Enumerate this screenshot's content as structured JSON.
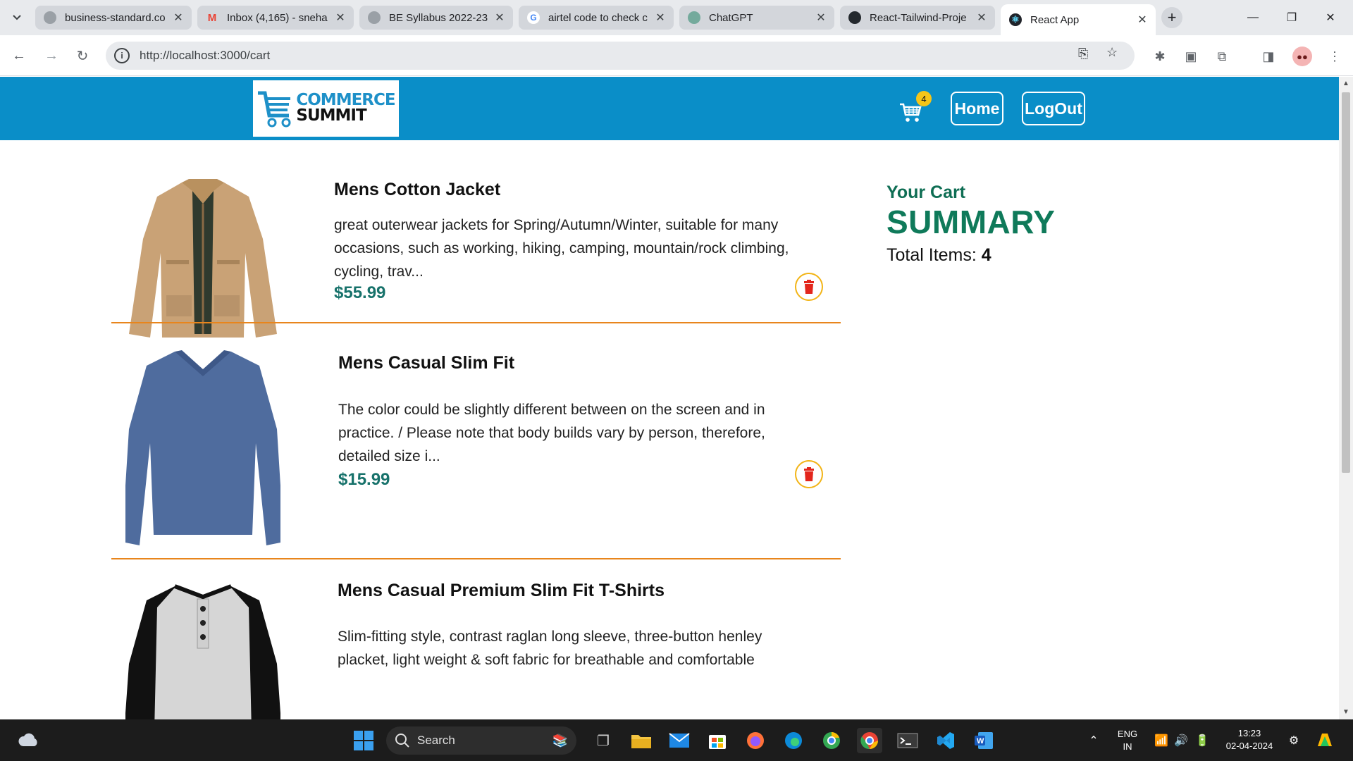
{
  "browser": {
    "tabs": [
      {
        "title": "business-standard.co",
        "icon": "globe-icon"
      },
      {
        "title": "Inbox (4,165) - sneha",
        "icon": "gmail-icon"
      },
      {
        "title": "BE Syllabus 2022-23.",
        "icon": "globe-icon"
      },
      {
        "title": "airtel code to check c",
        "icon": "google-icon"
      },
      {
        "title": "ChatGPT",
        "icon": "chatgpt-icon"
      },
      {
        "title": "React-Tailwind-Proje",
        "icon": "github-icon"
      },
      {
        "title": "React App",
        "icon": "react-icon"
      }
    ],
    "url": "http://localhost:3000/cart"
  },
  "navbar": {
    "logo_line1": "COMMERCE",
    "logo_line2": "SUMMIT",
    "cart_count": "4",
    "home_label": "Home",
    "logout_label": "LogOut"
  },
  "cart_items": [
    {
      "name": "Mens Cotton Jacket",
      "description": "great outerwear jackets for Spring/Autumn/Winter, suitable for many occasions, such as working, hiking, camping, mountain/rock climbing, cycling, trav...",
      "price": "$55.99"
    },
    {
      "name": "Mens Casual Slim Fit",
      "description": "The color could be slightly different between on the screen and in practice. / Please note that body builds vary by person, therefore, detailed size i...",
      "price": "$15.99"
    },
    {
      "name": "Mens Casual Premium Slim Fit T-Shirts",
      "description": "Slim-fitting style, contrast raglan long sleeve, three-button henley placket, light weight & soft fabric for breathable and comfortable",
      "price": ""
    }
  ],
  "summary": {
    "subtitle": "Your Cart",
    "title": "SUMMARY",
    "total_label": "Total Items:",
    "total_value": "4"
  },
  "taskbar": {
    "search_label": "Search",
    "lang_line1": "ENG",
    "lang_line2": "IN",
    "time": "13:23",
    "date": "02-04-2024"
  },
  "colors": {
    "navbar": "#0a8ec8",
    "price": "#17726b",
    "summary": "#0f7a5a",
    "divider": "#e8851c",
    "delete": "#e3261c"
  }
}
